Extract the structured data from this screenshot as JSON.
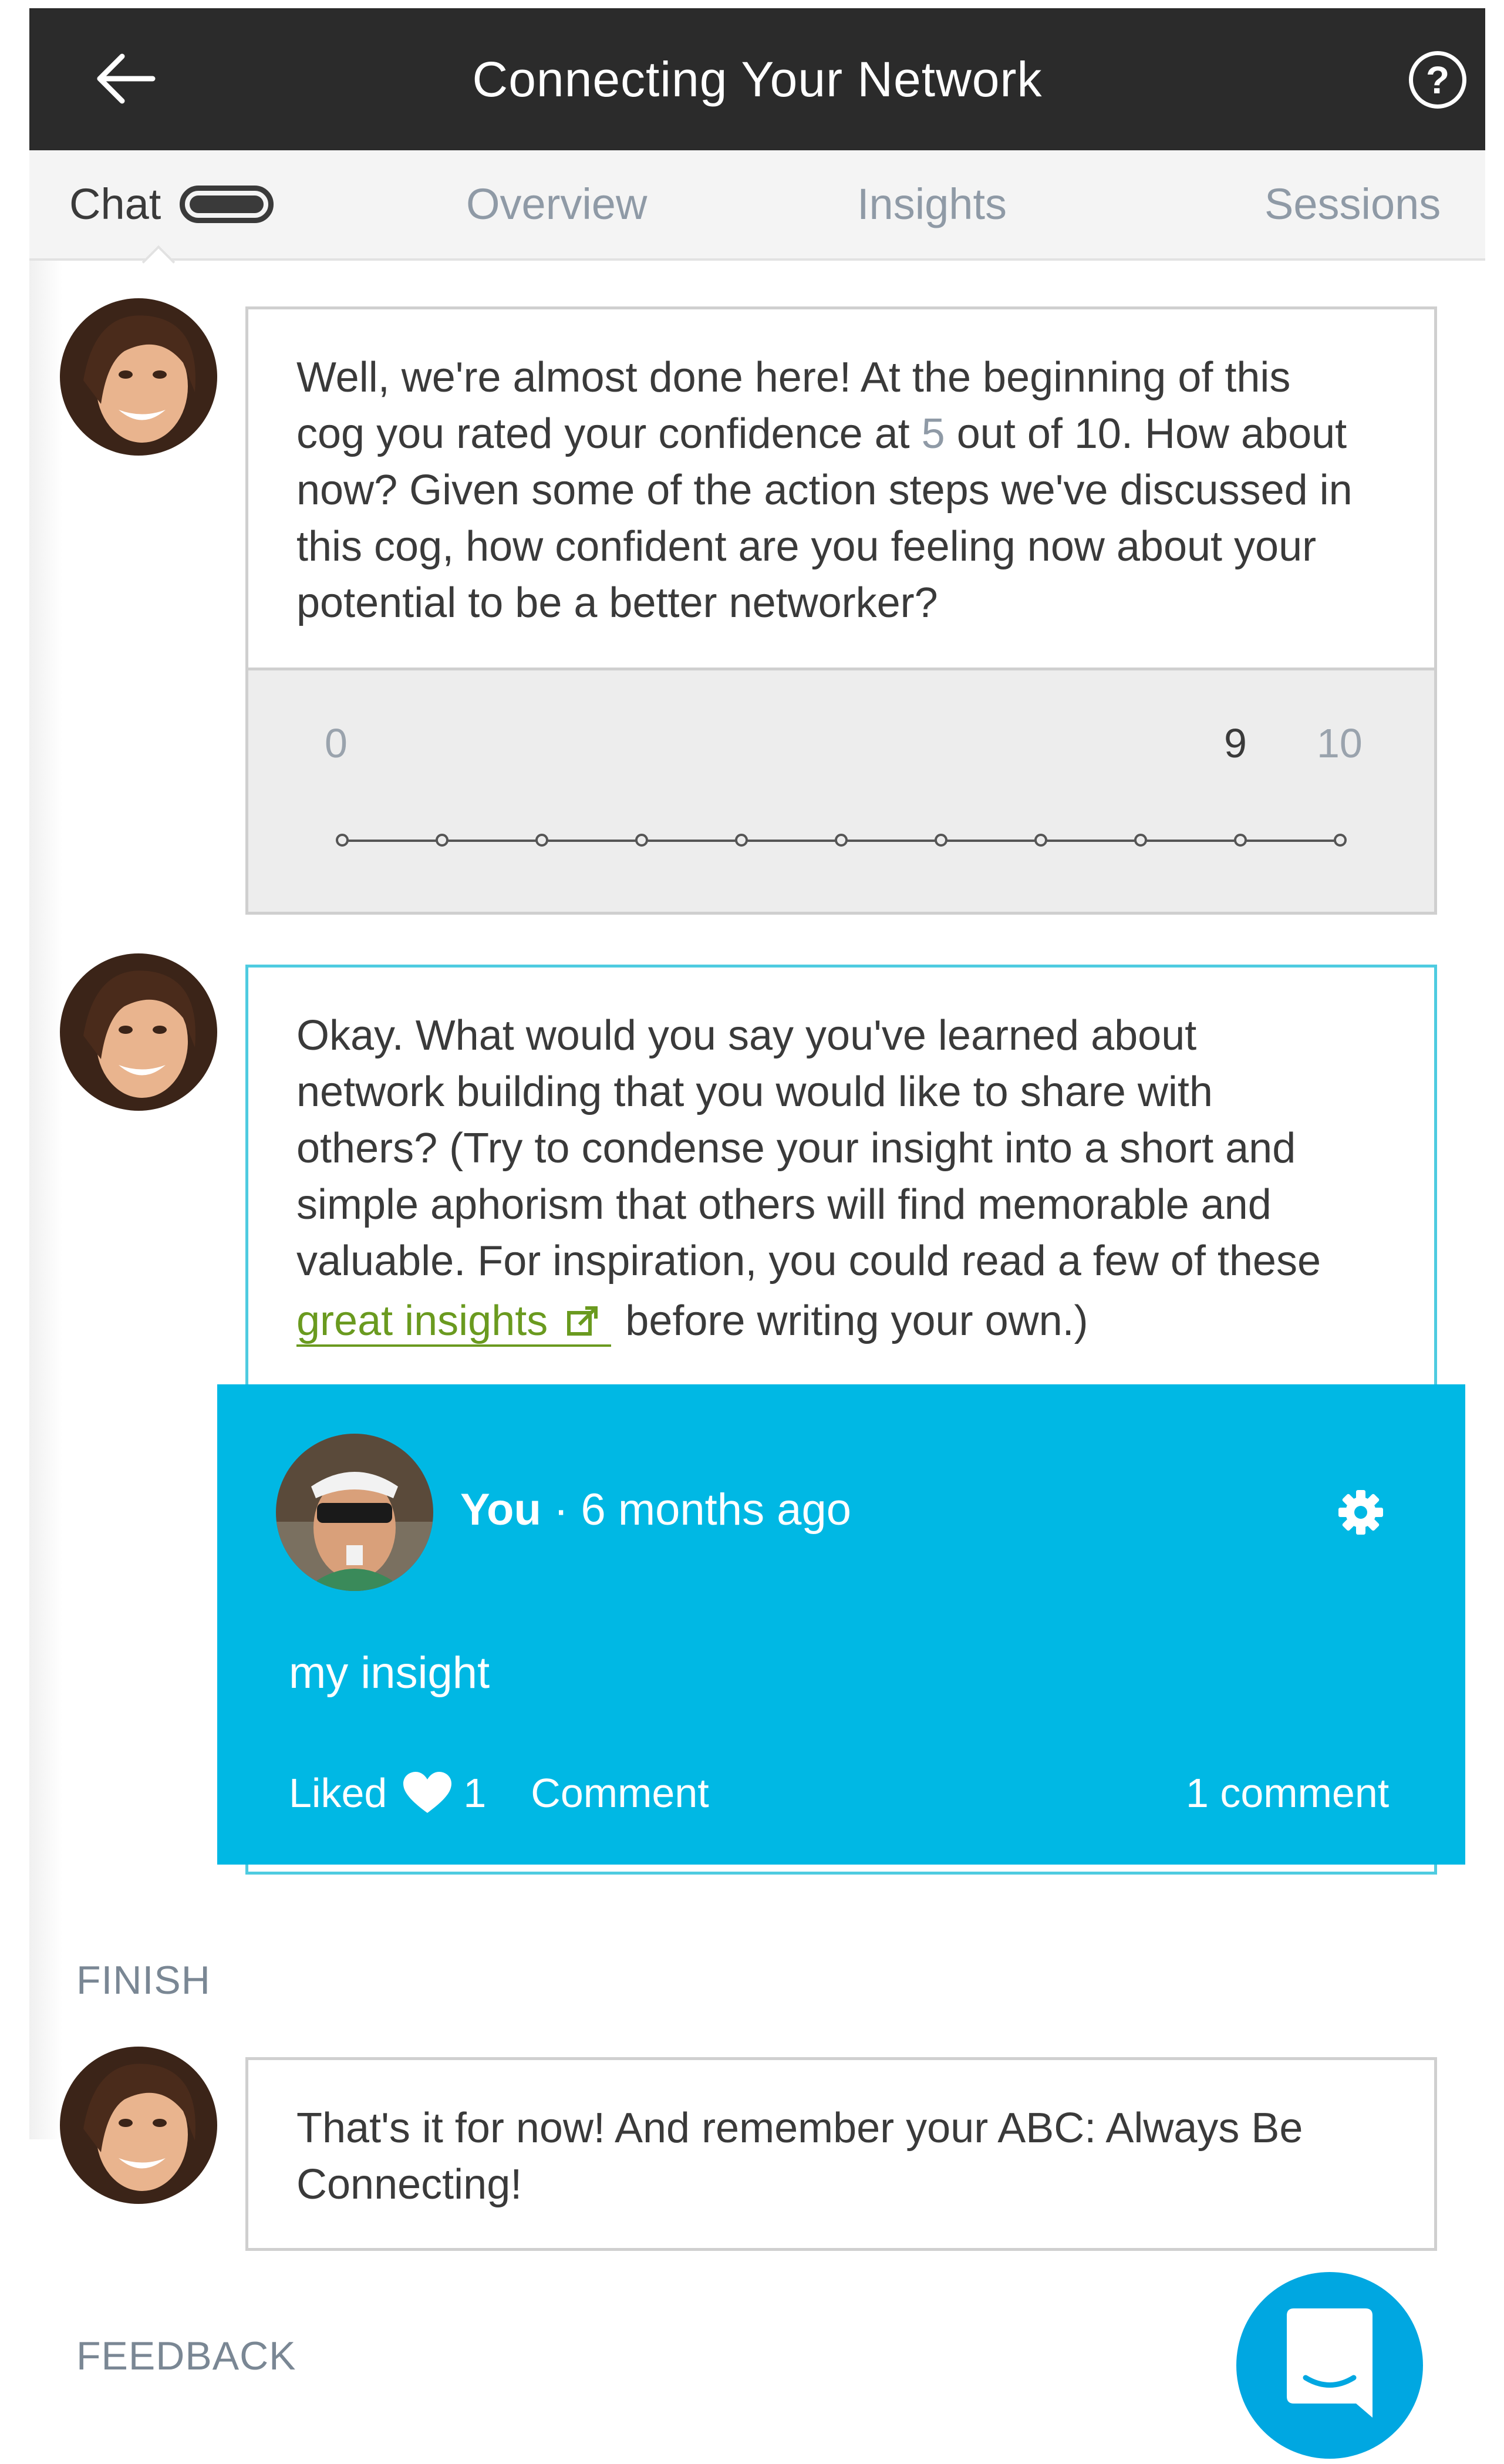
{
  "header": {
    "title": "Connecting Your Network",
    "back_icon": "arrow-left-icon",
    "help_icon": "question-circle-icon",
    "help_glyph": "?"
  },
  "tabs": [
    {
      "label": "Chat",
      "active": true
    },
    {
      "label": "Overview",
      "active": false
    },
    {
      "label": "Insights",
      "active": false
    },
    {
      "label": "Sessions",
      "active": false
    }
  ],
  "messages": {
    "q1": {
      "line1": "Well, we're almost done here! At the beginning of this",
      "line2_pre": "cog you rated your confidence at ",
      "line2_value": "5",
      "line2_post": " out of 10. How about",
      "line3": "now? Given some of the action steps we've discussed in",
      "line4": "this cog, how confident are you feeling now about your",
      "line5": "potential to be a better networker?"
    },
    "q2": {
      "line1": "Okay. What would you say you've learned about",
      "line2": "network building that you would like to share with",
      "line3": "others? (Try to condense your insight into a short and",
      "line4": "simple aphorism that others will find memorable and",
      "line5": "valuable. For inspiration, you could read a few of these",
      "link": "great insights",
      "link_icon": "external-link-icon",
      "line6_post": "before writing your own.)"
    },
    "q3": {
      "line1": "That's it for now! And remember your ABC: Always Be",
      "line2": "Connecting!"
    }
  },
  "slider": {
    "min_label": "0",
    "selected_label": "9",
    "max_label": "10",
    "selected_value": 9,
    "ticks": 11
  },
  "insight": {
    "author": "You",
    "time": "· 6 months ago",
    "text": "my insight",
    "liked_label": "Liked",
    "like_count": "1",
    "comment_label": "Comment",
    "comments_count": "1 comment",
    "settings_icon": "gear-icon",
    "heart_icon": "heart-icon"
  },
  "sections": {
    "finish": "FINISH",
    "feedback": "FEEDBACK"
  },
  "colors": {
    "header_bg": "#2b2b2b",
    "card_bg": "#00b8e4",
    "link": "#6a9a1f",
    "accent_border": "#4ecbe0",
    "intercom": "#00a7e1"
  }
}
